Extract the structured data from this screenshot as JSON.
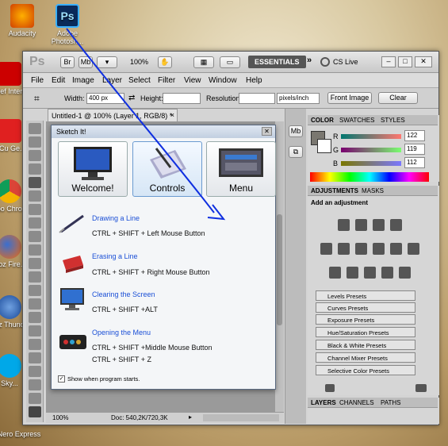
{
  "desktop": {
    "icons": [
      {
        "label": "Audacity"
      },
      {
        "label": "Adobe Photosh..."
      },
      {
        "label": "BitDef Intern..."
      },
      {
        "label": "InCu Ge..."
      },
      {
        "label": "Goo Chro..."
      },
      {
        "label": "Moz Fire..."
      },
      {
        "label": "Moz Thund..."
      },
      {
        "label": "Sky..."
      },
      {
        "label": "Nero Express"
      }
    ]
  },
  "ps": {
    "logo": "Ps",
    "br": "Br",
    "mb": "Mb",
    "zoom": "100%",
    "workspace": "ESSENTIALS",
    "cslive": "CS Live",
    "menu": [
      "File",
      "Edit",
      "Image",
      "Layer",
      "Select",
      "Filter",
      "View",
      "Window",
      "Help"
    ],
    "options": {
      "width_label": "Width:",
      "width_value": "400 px",
      "height_label": "Height:",
      "height_value": "",
      "resolution_label": "Resolution:",
      "resolution_value": "",
      "unit": "pixels/inch",
      "front_image": "Front Image",
      "clear": "Clear"
    },
    "doc_tab": "Untitled-1 @ 100% (Layer 1, RGB/8) *",
    "status": {
      "zoom": "100%",
      "doc": "Doc: 540,2K/720,3K"
    }
  },
  "sketch": {
    "title": "Sketch It!",
    "buttons": [
      {
        "label": "Welcome!"
      },
      {
        "label": "Controls"
      },
      {
        "label": "Menu"
      }
    ],
    "entries": [
      {
        "title": "Drawing a Line",
        "lines": [
          "CTRL + SHIFT + Left Mouse Button"
        ]
      },
      {
        "title": "Erasing a Line",
        "lines": [
          "CTRL + SHIFT + Right Mouse Button"
        ]
      },
      {
        "title": "Clearing the Screen",
        "lines": [
          "CTRL + SHIFT +ALT"
        ]
      },
      {
        "title": "Opening the Menu",
        "lines": [
          "CTRL + SHIFT +Middle Mouse Button",
          "CTRL + SHIFT + Z"
        ]
      }
    ],
    "checkbox": "Show when program starts."
  },
  "color_panel": {
    "tabs": [
      "COLOR",
      "SWATCHES",
      "STYLES"
    ],
    "r_label": "R",
    "g_label": "G",
    "b_label": "B",
    "r": "122",
    "g": "119",
    "b": "112"
  },
  "adjust_panel": {
    "tabs": [
      "ADJUSTMENTS",
      "MASKS"
    ],
    "heading": "Add an adjustment",
    "presets": [
      "Levels Presets",
      "Curves Presets",
      "Exposure Presets",
      "Hue/Saturation Presets",
      "Black & White Presets",
      "Channel Mixer Presets",
      "Selective Color Presets"
    ]
  },
  "layers_panel": {
    "tabs": [
      "LAYERS",
      "CHANNELS",
      "PATHS"
    ]
  },
  "colors": {
    "ps_gray": "#d4d4d4",
    "link_blue": "#1a4fd6",
    "arrow_blue": "#1030e0"
  }
}
